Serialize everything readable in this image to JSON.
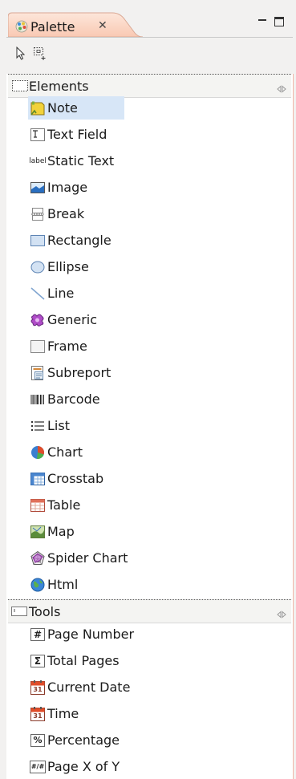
{
  "view": {
    "title": "Palette",
    "close_glyph": "✕",
    "icon": "palette-icon",
    "min_icon": "minimize-icon",
    "max_icon": "maximize-icon"
  },
  "toolbar": {
    "tools": [
      {
        "name": "select-tool",
        "icon": "arrow-pointer-icon"
      },
      {
        "name": "marquee-tool",
        "icon": "marquee-icon"
      }
    ]
  },
  "drawers": [
    {
      "label": "Elements",
      "items": [
        {
          "label": "Note",
          "icon": "note-icon",
          "selected": true
        },
        {
          "label": "Text Field",
          "icon": "text-field-icon"
        },
        {
          "label": "Static Text",
          "icon": "static-text-icon",
          "icon_text": "label"
        },
        {
          "label": "Image",
          "icon": "image-icon"
        },
        {
          "label": "Break",
          "icon": "break-icon"
        },
        {
          "label": "Rectangle",
          "icon": "rectangle-icon"
        },
        {
          "label": "Ellipse",
          "icon": "ellipse-icon"
        },
        {
          "label": "Line",
          "icon": "line-icon"
        },
        {
          "label": "Generic",
          "icon": "generic-icon"
        },
        {
          "label": "Frame",
          "icon": "frame-icon"
        },
        {
          "label": "Subreport",
          "icon": "subreport-icon"
        },
        {
          "label": "Barcode",
          "icon": "barcode-icon"
        },
        {
          "label": "List",
          "icon": "list-icon"
        },
        {
          "label": "Chart",
          "icon": "chart-icon"
        },
        {
          "label": "Crosstab",
          "icon": "crosstab-icon"
        },
        {
          "label": "Table",
          "icon": "table-icon"
        },
        {
          "label": "Map",
          "icon": "map-icon"
        },
        {
          "label": "Spider Chart",
          "icon": "spider-chart-icon"
        },
        {
          "label": "Html",
          "icon": "html-icon"
        }
      ]
    },
    {
      "label": "Tools",
      "items": [
        {
          "label": "Page Number",
          "icon": "page-number-icon",
          "icon_text": "#"
        },
        {
          "label": "Total Pages",
          "icon": "total-pages-icon",
          "icon_text": "Σ"
        },
        {
          "label": "Current Date",
          "icon": "current-date-icon",
          "icon_text": "31"
        },
        {
          "label": "Time",
          "icon": "time-icon",
          "icon_text": "31"
        },
        {
          "label": "Percentage",
          "icon": "percentage-icon",
          "icon_text": "%"
        },
        {
          "label": "Page X of Y",
          "icon": "page-x-of-y-icon",
          "icon_text": "#/#"
        }
      ]
    }
  ],
  "colors": {
    "tab_bg": "#fcd8c8",
    "selection": "#d7e6f7",
    "border_accent": "#f0b5a8"
  }
}
